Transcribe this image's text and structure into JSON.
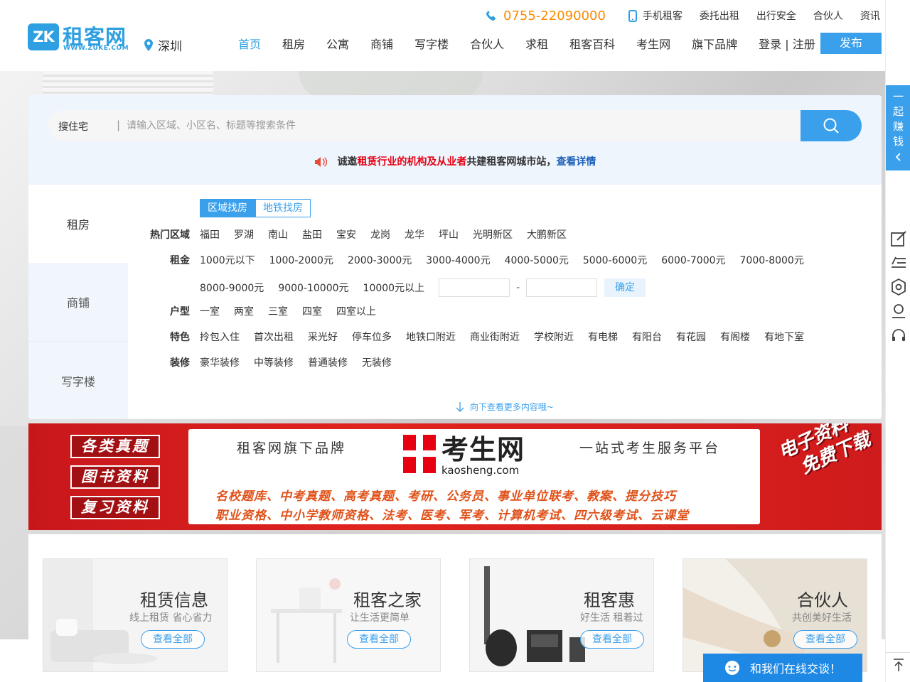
{
  "logo": {
    "mark": "ZK",
    "cn": "租客网",
    "en": "WWW.ZUKE.COM"
  },
  "city": "深圳",
  "topbar": {
    "phone": "0755-22090000",
    "items": [
      "手机租客",
      "委托出租",
      "出行安全",
      "合伙人",
      "资讯"
    ]
  },
  "nav": {
    "items": [
      "首页",
      "租房",
      "公寓",
      "商铺",
      "写字楼",
      "合伙人",
      "求租",
      "租客百科",
      "考生网",
      "旗下品牌"
    ],
    "login": "登录 | 注册",
    "publish": "发布"
  },
  "search": {
    "type": "搜住宅",
    "separator": "|",
    "placeholder": "请输入区域、小区名、标题等搜索条件"
  },
  "invite": {
    "part1": "诚邀",
    "part2": "租赁行业的机构及从业者",
    "part3": "共建租客网城市站，",
    "link": "查看详情"
  },
  "side_tabs": [
    "租房",
    "商铺",
    "写字楼"
  ],
  "filter": {
    "tabs": [
      "区域找房",
      "地铁找房"
    ],
    "area": {
      "label": "热门区域",
      "options": [
        "福田",
        "罗湖",
        "南山",
        "盐田",
        "宝安",
        "龙岗",
        "龙华",
        "坪山",
        "光明新区",
        "大鹏新区"
      ]
    },
    "rent": {
      "label": "租金",
      "options_row1": [
        "1000元以下",
        "1000-2000元",
        "2000-3000元",
        "3000-4000元",
        "4000-5000元",
        "5000-6000元",
        "6000-7000元",
        "7000-8000元"
      ],
      "options_row2": [
        "8000-9000元",
        "9000-10000元",
        "10000元以上"
      ],
      "dash": "-",
      "confirm": "确定"
    },
    "layout": {
      "label": "户型",
      "options": [
        "一室",
        "两室",
        "三室",
        "四室",
        "四室以上"
      ]
    },
    "feature": {
      "label": "特色",
      "options": [
        "拎包入住",
        "首次出租",
        "采光好",
        "停车位多",
        "地铁口附近",
        "商业街附近",
        "学校附近",
        "有电梯",
        "有阳台",
        "有花园",
        "有阁楼",
        "有地下室"
      ]
    },
    "decor": {
      "label": "装修",
      "options": [
        "豪华装修",
        "中等装修",
        "普通装修",
        "无装修"
      ]
    },
    "more": "向下查看更多内容哦~"
  },
  "banner": {
    "boxes": [
      "各类真题",
      "图书资料",
      "复习资料"
    ],
    "brand": "租客网旗下品牌",
    "logo_cn": "考生网",
    "logo_en": "kaosheng.com",
    "slogan": "一站式考生服务平台",
    "line1": "名校题库、中考真题、高考真题、考研、公务员、事业单位联考、教案、提分技巧",
    "line2": "职业资格、中小学教师资格、法考、医考、军考、计算机考试、四六级考试、云课堂",
    "right1": "电子资料",
    "right2": "免费下载"
  },
  "cards": [
    {
      "title": "租赁信息",
      "sub": "线上租赁 省心省力",
      "btn": "查看全部"
    },
    {
      "title": "租客之家",
      "sub": "让生活更简单",
      "btn": "查看全部"
    },
    {
      "title": "租客惠",
      "sub": "好生活 租着过",
      "btn": "查看全部"
    },
    {
      "title": "合伙人",
      "sub": "共创美好生活",
      "btn": "查看全部"
    }
  ],
  "sidebar": {
    "invite_chars": [
      "一",
      "起",
      "赚",
      "钱"
    ]
  },
  "chat": "和我们在线交谈！",
  "colors": {
    "accent": "#3aa0ec",
    "phone": "#ff8a00",
    "banner_red": "#d01b1c"
  },
  "icons": [
    "phone-icon",
    "mobile-icon",
    "location-pin-icon",
    "search-icon",
    "speaker-icon",
    "arrow-down-icon",
    "edit-icon",
    "list-icon",
    "settings-icon",
    "user-icon",
    "headset-icon",
    "arrow-up-icon",
    "chat-icon",
    "chevron-left-icon"
  ]
}
